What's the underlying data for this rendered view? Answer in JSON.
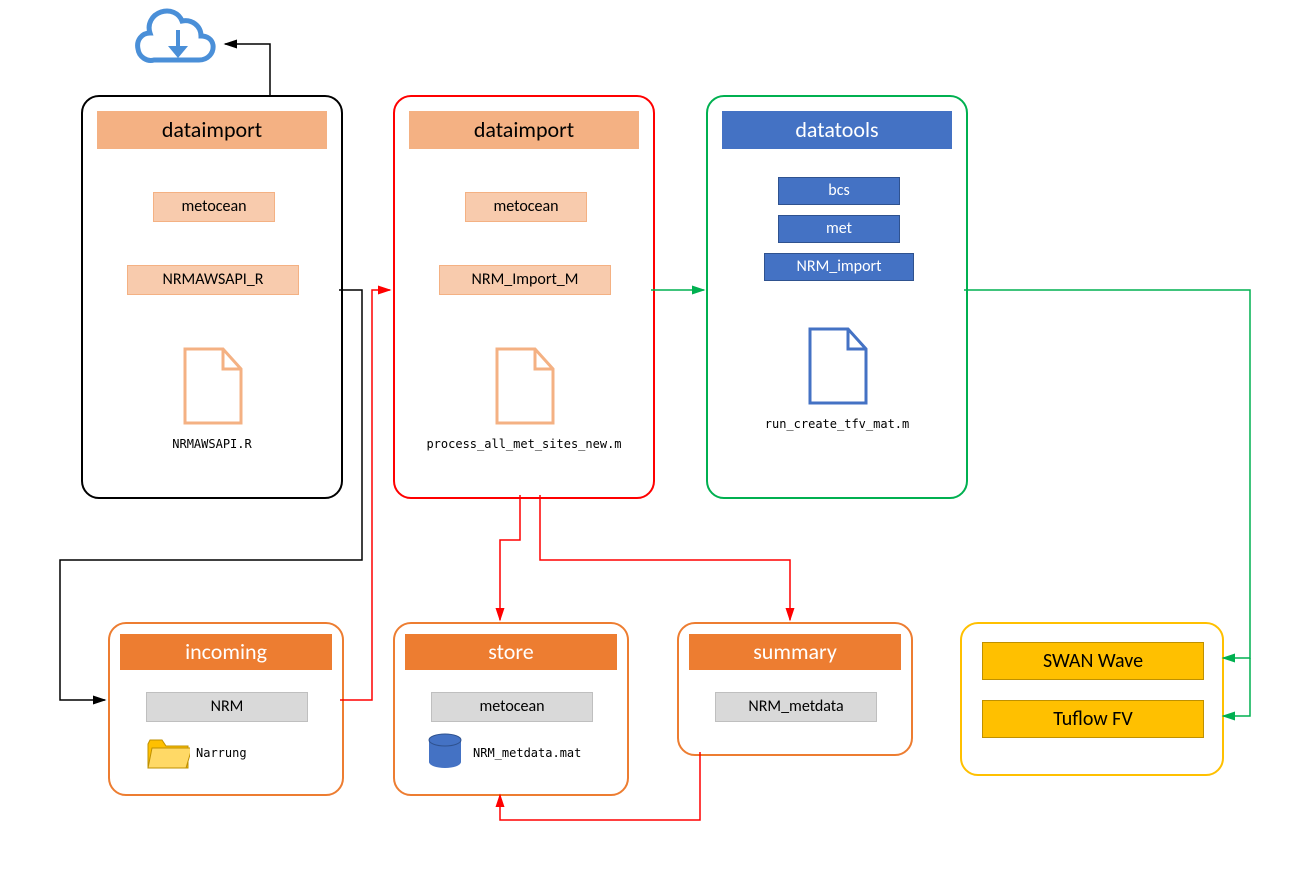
{
  "cloud": {
    "icon": "cloud-download"
  },
  "box1": {
    "title": "dataimport",
    "items": [
      "metocean",
      "NRMAWSAPI_R"
    ],
    "file": "NRMAWSAPI.R"
  },
  "box2": {
    "title": "dataimport",
    "items": [
      "metocean",
      "NRM_Import_M"
    ],
    "file": "process_all_met_sites_new.m"
  },
  "box3": {
    "title": "datatools",
    "items": [
      "bcs",
      "met",
      "NRM_import"
    ],
    "file": "run_create_tfv_mat.m"
  },
  "incoming": {
    "title": "incoming",
    "items": [
      "NRM"
    ],
    "folder": "Narrung"
  },
  "store": {
    "title": "store",
    "items": [
      "metocean"
    ],
    "db": "NRM_metdata.mat"
  },
  "summary": {
    "title": "summary",
    "items": [
      "NRM_metdata"
    ]
  },
  "outputs": {
    "items": [
      "SWAN Wave",
      "Tuflow FV"
    ]
  }
}
